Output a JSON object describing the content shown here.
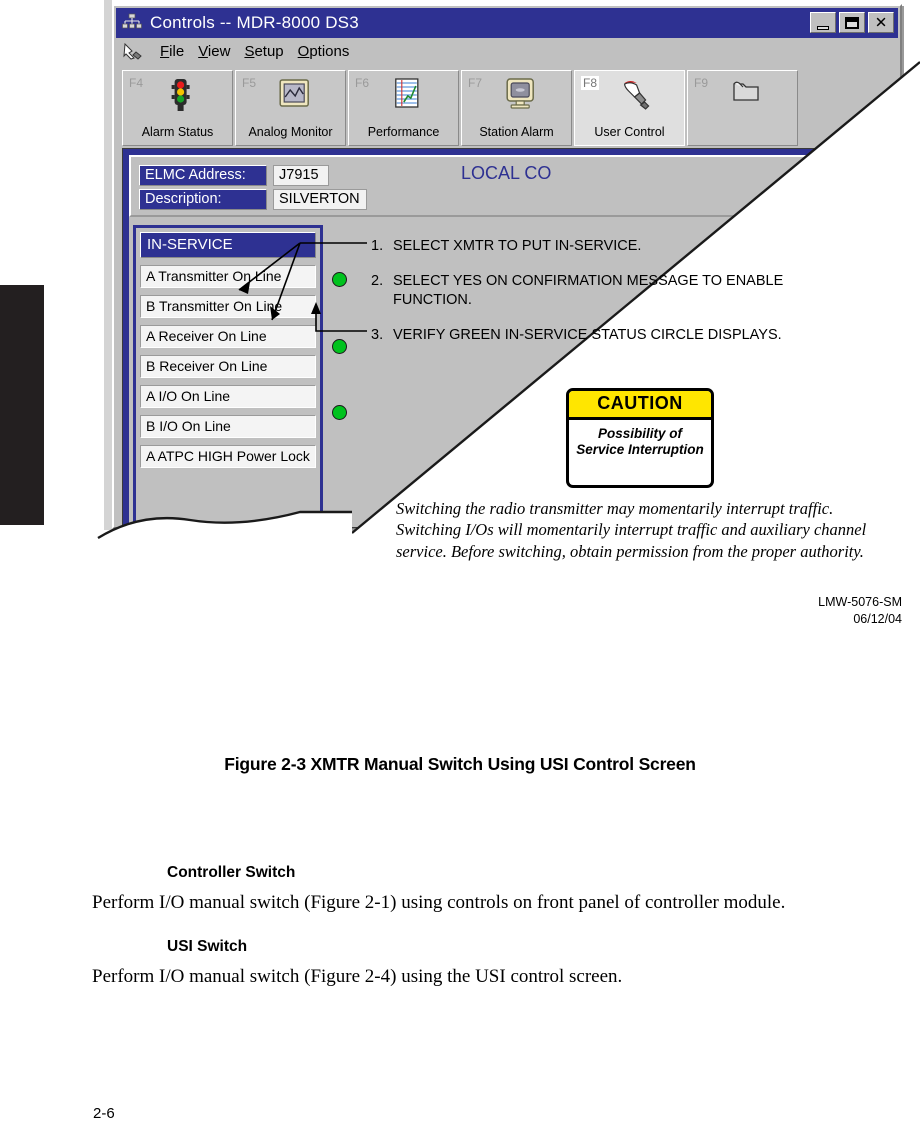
{
  "window": {
    "title": "Controls -- MDR-8000 DS3",
    "title_icon": "network-tree-icon",
    "controls": {
      "minimize": "minimize-icon",
      "maximize": "maximize-icon",
      "close": "close-icon"
    }
  },
  "menu": {
    "icon": "pointer-hand-icon",
    "items": [
      "File",
      "View",
      "Setup",
      "Options"
    ]
  },
  "toolbar": {
    "buttons": [
      {
        "key": "F4",
        "label": "Alarm Status",
        "icon": "traffic-light-icon",
        "active": false
      },
      {
        "key": "F5",
        "label": "Analog Monitor",
        "icon": "waveform-monitor-icon",
        "active": false
      },
      {
        "key": "F6",
        "label": "Performance",
        "icon": "chart-page-icon",
        "active": false
      },
      {
        "key": "F7",
        "label": "Station Alarm",
        "icon": "monitor-icon",
        "active": false
      },
      {
        "key": "F8",
        "label": "User Control",
        "icon": "hand-pointer-icon",
        "active": true
      },
      {
        "key": "F9",
        "label": "",
        "icon": "folder-icon",
        "active": false
      }
    ]
  },
  "screen": {
    "mode_label": "LOCAL CO",
    "fields": [
      {
        "label": "ELMC Address:",
        "value": "J7915"
      },
      {
        "label": "Description:",
        "value": "SILVERTON"
      }
    ],
    "panel": {
      "header": "IN-SERVICE",
      "items": [
        {
          "label": "A Transmitter On Line",
          "status": true
        },
        {
          "label": "B Transmitter On Line",
          "status": false
        },
        {
          "label": "A Receiver On Line",
          "status": true
        },
        {
          "label": "B Receiver On Line",
          "status": false
        },
        {
          "label": "A I/O On Line",
          "status": true
        },
        {
          "label": "B I/O On Line",
          "status": false
        },
        {
          "label": "A ATPC HIGH Power Lock",
          "status": false
        }
      ]
    }
  },
  "instructions": [
    {
      "num": "1.",
      "text": "SELECT XMTR TO PUT IN-SERVICE."
    },
    {
      "num": "2.",
      "text": "SELECT YES ON CONFIRMATION MESSAGE TO ENABLE FUNCTION."
    },
    {
      "num": "3.",
      "text": "VERIFY GREEN IN-SERVICE STATUS CIRCLE DISPLAYS."
    }
  ],
  "caution": {
    "heading": "CAUTION",
    "body": "Possibility of Service Interruption",
    "banner_color": "#ffe600"
  },
  "warning_text": "Switching the radio transmitter may momentarily interrupt traffic. Switching I/Os will momentarily interrupt traffic and auxiliary channel service. Before switching, obtain permission from the proper authority.",
  "doc_ref": {
    "number": "LMW-5076-SM",
    "date": "06/12/04"
  },
  "figure_caption": "Figure 2-3  XMTR Manual Switch Using USI Control Screen",
  "sections": [
    {
      "heading": "Controller Switch",
      "body": "Perform I/O manual switch (Figure 2-1) using controls on front panel of controller module."
    },
    {
      "heading": "USI Switch",
      "body": "Perform I/O manual switch (Figure 2-4) using the USI control screen."
    }
  ],
  "page_number": "2-6",
  "colors": {
    "title_blue": "#2e3192",
    "status_green": "#00c21e",
    "caution_yellow": "#ffe600",
    "chrome_gray": "#c0c0c0"
  }
}
